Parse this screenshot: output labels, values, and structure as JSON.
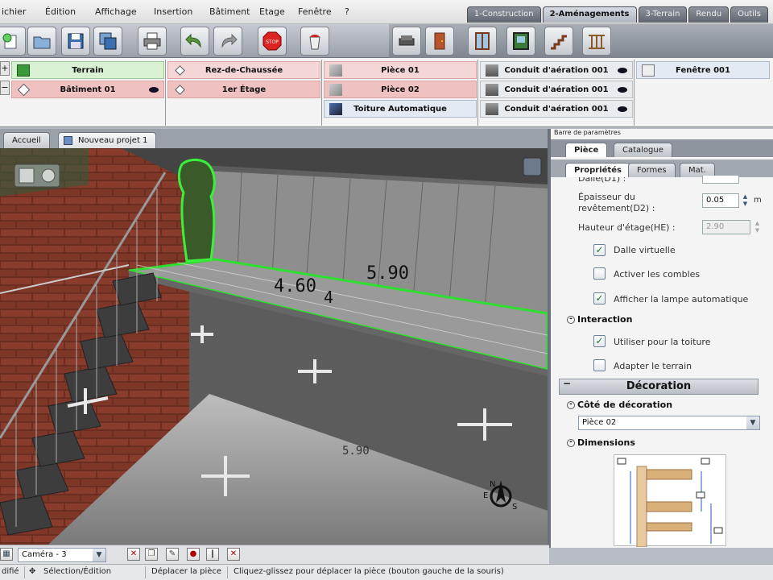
{
  "menu": [
    "ichier",
    "Édition",
    "Affichage",
    "Insertion",
    "Bâtiment",
    "Etage",
    "Fenêtre",
    "?"
  ],
  "mode_tabs": [
    {
      "label": "1-Construction",
      "active": false
    },
    {
      "label": "2-Aménagements",
      "active": true
    },
    {
      "label": "3-Terrain",
      "active": false
    },
    {
      "label": "Rendu",
      "active": false
    },
    {
      "label": "Outils",
      "active": false
    }
  ],
  "toolbar_icons": [
    "new-project-icon",
    "open-folder-icon",
    "save-icon",
    "save-as-icon",
    "print-icon",
    "undo-icon",
    "redo-icon",
    "stop-icon",
    "paint-bucket-icon",
    "sofa-icon",
    "door-icon",
    "window-icon",
    "painting-icon",
    "stairs-icon",
    "railing-icon"
  ],
  "levels": {
    "col1": [
      {
        "label": "Terrain"
      },
      {
        "label": "Bâtiment 01"
      }
    ],
    "col2": [
      {
        "label": "Rez-de-Chaussée"
      },
      {
        "label": "1er Étage"
      }
    ],
    "col3": [
      {
        "label": "Pièce 01"
      },
      {
        "label": "Pièce 02"
      },
      {
        "label": "Toiture Automatique"
      }
    ],
    "col4": [
      {
        "label": "Conduit d'aération 001"
      },
      {
        "label": "Conduit d'aération 001"
      },
      {
        "label": "Conduit d'aération 001"
      }
    ],
    "col5": [
      {
        "label": "Fenêtre 001"
      }
    ]
  },
  "view_tabs": [
    "Accueil",
    "Nouveau projet 1"
  ],
  "viewport": {
    "dimension_labels": [
      "5.90",
      "4.60",
      "4",
      "5.90"
    ],
    "compass_letters": [
      "N",
      "E",
      "S"
    ]
  },
  "panel": {
    "title": "Barre de paramètres",
    "tabs1": [
      {
        "label": "Pièce",
        "active": true
      },
      {
        "label": "Catalogue",
        "active": false
      }
    ],
    "tabs2": [
      {
        "label": "Propriétés",
        "active": true
      },
      {
        "label": "Formes",
        "active": false
      },
      {
        "label": "Mat.",
        "active": false
      }
    ],
    "dalle_partial": "Dalle(D1) :",
    "revetement_label": "Épaisseur du revêtement(D2) :",
    "revetement_value": "0.05",
    "unit": "m",
    "hauteur_label": "Hauteur d'étage(HE) :",
    "hauteur_value": "2.90",
    "checkboxes": [
      {
        "label": "Dalle virtuelle",
        "checked": true
      },
      {
        "label": "Activer les combles",
        "checked": false
      },
      {
        "label": "Afficher la lampe automatique",
        "checked": true
      }
    ],
    "interaction_title": "Interaction",
    "interaction_checkboxes": [
      {
        "label": "Utiliser pour la toiture",
        "checked": true
      },
      {
        "label": "Adapter le terrain",
        "checked": false
      }
    ],
    "decoration_title": "Décoration",
    "cote_title": "Côté de décoration",
    "cote_value": "Pièce 02",
    "dimensions_title": "Dimensions"
  },
  "bottombar": {
    "camera": "Caméra - 3"
  },
  "status": {
    "left": "difié",
    "mode": "Sélection/Édition",
    "action": "Déplacer la pièce",
    "hint": "Cliquez-glissez pour déplacer la pièce (bouton gauche de la souris)"
  }
}
